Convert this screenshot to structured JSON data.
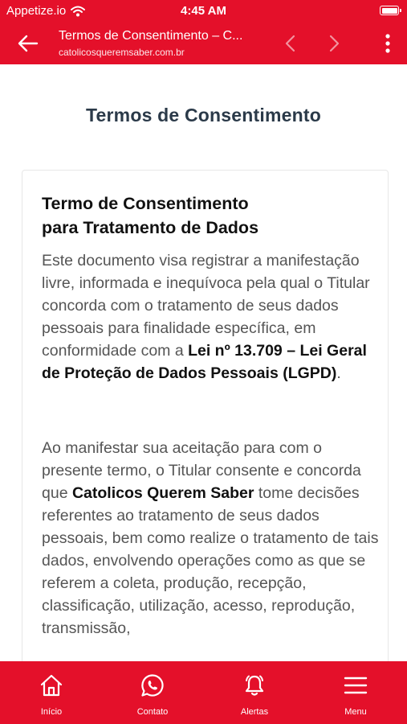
{
  "status_bar": {
    "carrier": "Appetize.io",
    "time": "4:45 AM"
  },
  "toolbar": {
    "title": "Termos de Consentimento – C...",
    "url": "catolicosqueremsaber.com.br"
  },
  "page": {
    "title": "Termos de Consentimento",
    "card": {
      "heading_line1": "Termo de Consentimento",
      "heading_line2": "para Tratamento de Dados",
      "p1_text": "Este documento visa registrar a manifestação livre, informada e inequívoca pela qual o Titular concorda com o tratamento de seus dados pessoais para finalidade específica, em conformidade com a ",
      "p1_bold": "Lei nº 13.709 – Lei Geral de Proteção de Dados Pessoais (LGPD)",
      "p1_end": ".",
      "p2_text_a": "Ao manifestar sua aceitação para com o presente termo, o Titular consente e concorda que ",
      "p2_bold": "Catolicos Querem Saber",
      "p2_text_b": " tome decisões referentes ao tratamento de seus dados pessoais, bem como realize o tratamento de tais dados, envolvendo operações como as que se referem a coleta, produção, recepção, classificação, utilização, acesso, reprodução, transmissão,"
    }
  },
  "tabbar": {
    "home": "Início",
    "contact": "Contato",
    "alerts": "Alertas",
    "menu": "Menu"
  },
  "colors": {
    "brand": "#e4102a",
    "title": "#2b3a49",
    "body_text": "#555555"
  },
  "icons": {
    "back": "arrow-left-icon",
    "prev": "chevron-left-icon",
    "next": "chevron-right-icon",
    "more": "more-vertical-icon",
    "home": "home-icon",
    "whatsapp": "whatsapp-icon",
    "bell": "bell-icon",
    "menu": "hamburger-icon",
    "wifi": "wifi-icon",
    "battery": "battery-icon"
  }
}
